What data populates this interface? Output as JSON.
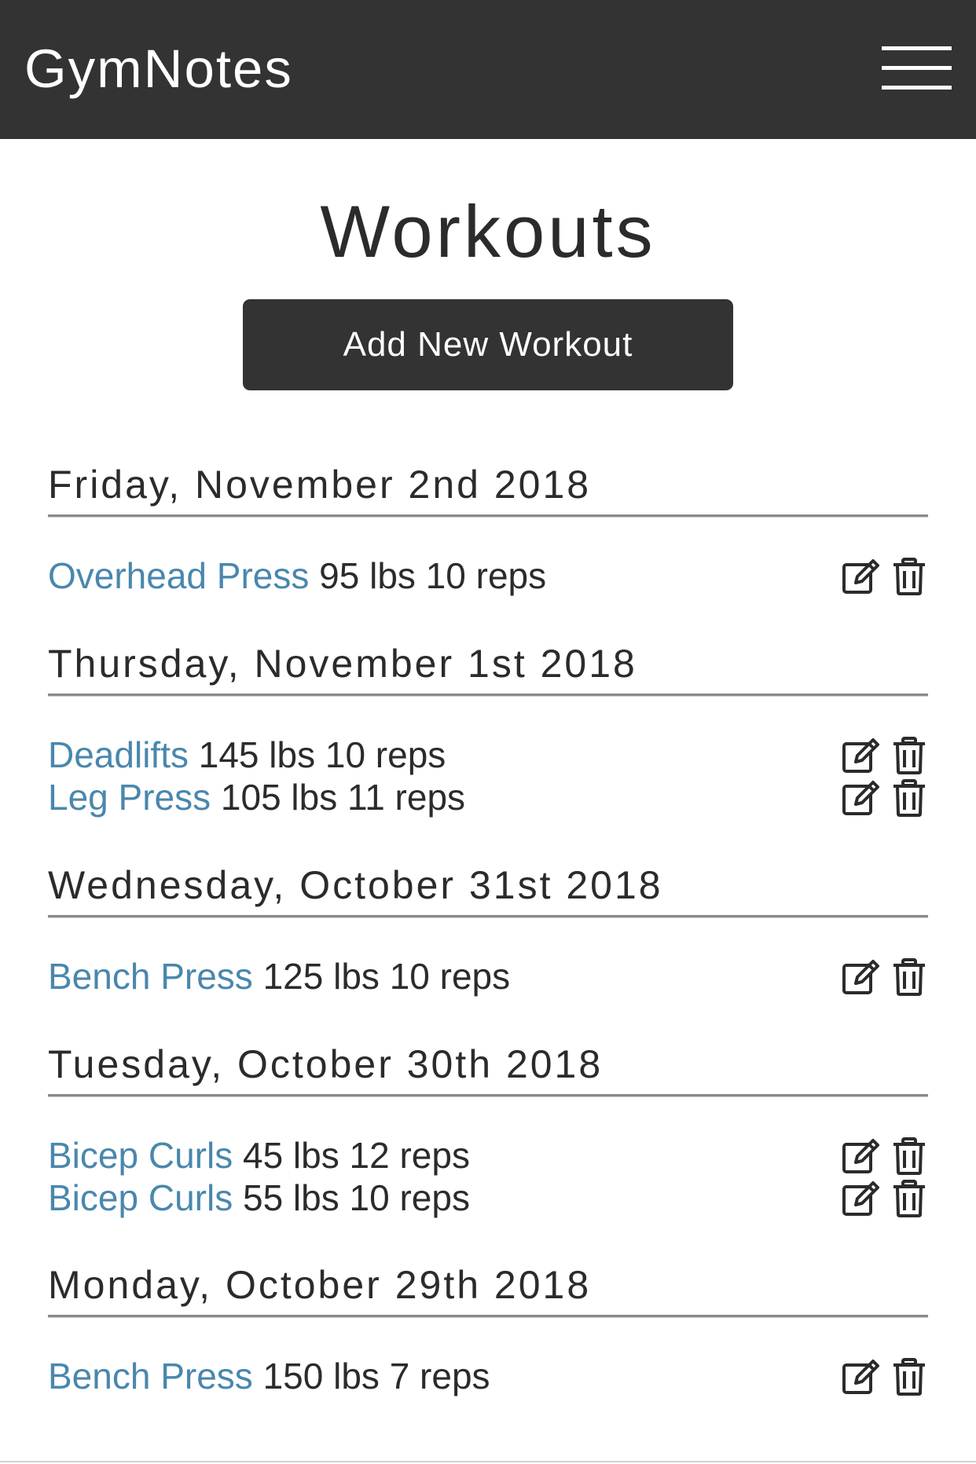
{
  "navbar": {
    "brand": "GymNotes",
    "menu_icon": "hamburger-menu-icon"
  },
  "page": {
    "title": "Workouts",
    "add_button": "Add New Workout"
  },
  "icons": {
    "edit": "edit-icon",
    "delete": "trash-icon"
  },
  "colors": {
    "navbar_bg": "#333333",
    "exercise_link": "#4a87ad",
    "text": "#2b2b2b"
  },
  "days": [
    {
      "date": "Friday, November 2nd 2018",
      "entries": [
        {
          "exercise": "Overhead Press",
          "detail": "95 lbs 10 reps"
        }
      ]
    },
    {
      "date": "Thursday, November 1st 2018",
      "entries": [
        {
          "exercise": "Deadlifts",
          "detail": "145 lbs 10 reps"
        },
        {
          "exercise": "Leg Press",
          "detail": "105 lbs 11 reps"
        }
      ]
    },
    {
      "date": "Wednesday, October 31st 2018",
      "entries": [
        {
          "exercise": "Bench Press",
          "detail": "125 lbs 10 reps"
        }
      ]
    },
    {
      "date": "Tuesday, October 30th 2018",
      "entries": [
        {
          "exercise": "Bicep Curls",
          "detail": "45 lbs 12 reps"
        },
        {
          "exercise": "Bicep Curls",
          "detail": "55 lbs 10 reps"
        }
      ]
    },
    {
      "date": "Monday, October 29th 2018",
      "entries": [
        {
          "exercise": "Bench Press",
          "detail": "150 lbs 7 reps"
        }
      ]
    }
  ]
}
